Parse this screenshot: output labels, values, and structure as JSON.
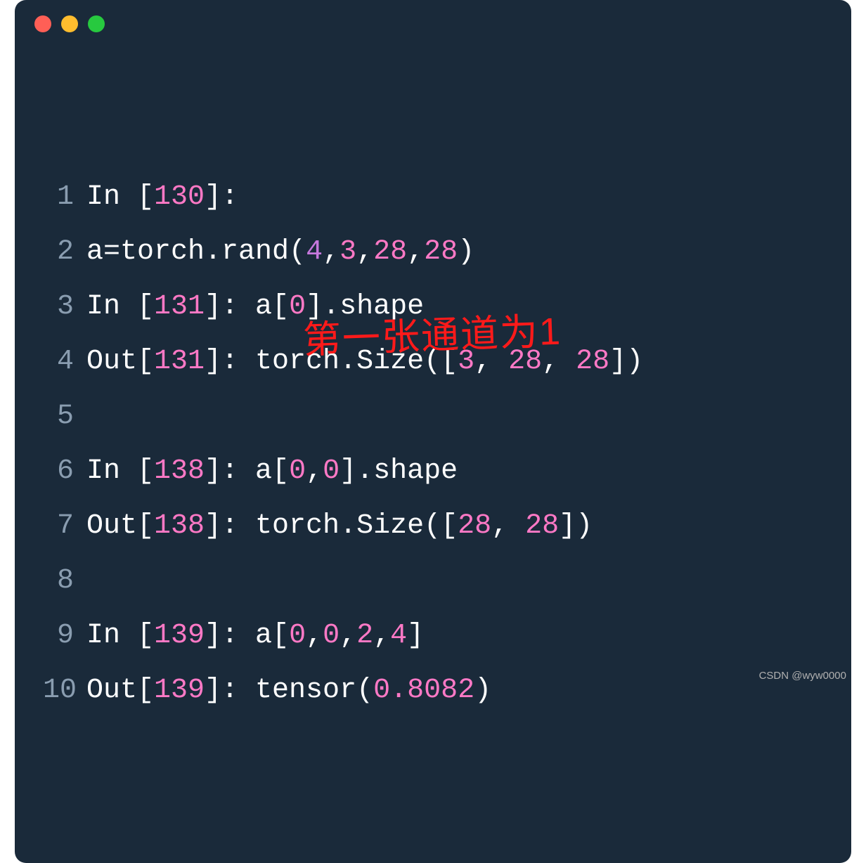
{
  "lines": [
    {
      "n": "1",
      "segments": [
        {
          "t": "In [",
          "c": "c-white"
        },
        {
          "t": "130",
          "c": "c-pink"
        },
        {
          "t": "]:",
          "c": "c-white"
        }
      ]
    },
    {
      "n": "2",
      "segments": [
        {
          "t": "a=torch.rand(",
          "c": "c-white"
        },
        {
          "t": "4",
          "c": "c-purple"
        },
        {
          "t": ",",
          "c": "c-white"
        },
        {
          "t": "3",
          "c": "c-pink"
        },
        {
          "t": ",",
          "c": "c-white"
        },
        {
          "t": "28",
          "c": "c-pink"
        },
        {
          "t": ",",
          "c": "c-white"
        },
        {
          "t": "28",
          "c": "c-pink"
        },
        {
          "t": ")",
          "c": "c-white"
        }
      ]
    },
    {
      "n": "3",
      "segments": [
        {
          "t": "In [",
          "c": "c-white"
        },
        {
          "t": "131",
          "c": "c-pink"
        },
        {
          "t": "]: a[",
          "c": "c-white"
        },
        {
          "t": "0",
          "c": "c-pink"
        },
        {
          "t": "].shape",
          "c": "c-white"
        }
      ]
    },
    {
      "n": "4",
      "segments": [
        {
          "t": "Out[",
          "c": "c-white"
        },
        {
          "t": "131",
          "c": "c-pink"
        },
        {
          "t": "]: torch.Size([",
          "c": "c-white"
        },
        {
          "t": "3",
          "c": "c-pink"
        },
        {
          "t": ", ",
          "c": "c-white"
        },
        {
          "t": "28",
          "c": "c-pink"
        },
        {
          "t": ", ",
          "c": "c-white"
        },
        {
          "t": "28",
          "c": "c-pink"
        },
        {
          "t": "])",
          "c": "c-white"
        }
      ]
    },
    {
      "n": "5",
      "segments": []
    },
    {
      "n": "6",
      "segments": [
        {
          "t": "In [",
          "c": "c-white"
        },
        {
          "t": "138",
          "c": "c-pink"
        },
        {
          "t": "]: a[",
          "c": "c-white"
        },
        {
          "t": "0",
          "c": "c-pink"
        },
        {
          "t": ",",
          "c": "c-white"
        },
        {
          "t": "0",
          "c": "c-pink"
        },
        {
          "t": "].shape",
          "c": "c-white"
        }
      ]
    },
    {
      "n": "7",
      "segments": [
        {
          "t": "Out[",
          "c": "c-white"
        },
        {
          "t": "138",
          "c": "c-pink"
        },
        {
          "t": "]: torch.Size([",
          "c": "c-white"
        },
        {
          "t": "28",
          "c": "c-pink"
        },
        {
          "t": ", ",
          "c": "c-white"
        },
        {
          "t": "28",
          "c": "c-pink"
        },
        {
          "t": "])",
          "c": "c-white"
        }
      ]
    },
    {
      "n": "8",
      "segments": []
    },
    {
      "n": "9",
      "segments": [
        {
          "t": "In [",
          "c": "c-white"
        },
        {
          "t": "139",
          "c": "c-pink"
        },
        {
          "t": "]: a[",
          "c": "c-white"
        },
        {
          "t": "0",
          "c": "c-pink"
        },
        {
          "t": ",",
          "c": "c-white"
        },
        {
          "t": "0",
          "c": "c-pink"
        },
        {
          "t": ",",
          "c": "c-white"
        },
        {
          "t": "2",
          "c": "c-pink"
        },
        {
          "t": ",",
          "c": "c-white"
        },
        {
          "t": "4",
          "c": "c-pink"
        },
        {
          "t": "]",
          "c": "c-white"
        }
      ]
    },
    {
      "n": "10",
      "segments": [
        {
          "t": "Out[",
          "c": "c-white"
        },
        {
          "t": "139",
          "c": "c-pink"
        },
        {
          "t": "]: tensor(",
          "c": "c-white"
        },
        {
          "t": "0.8082",
          "c": "c-pink"
        },
        {
          "t": ")",
          "c": "c-white"
        }
      ]
    }
  ],
  "annotation": "第一张通道为1",
  "watermark": "CSDN @wyw0000"
}
